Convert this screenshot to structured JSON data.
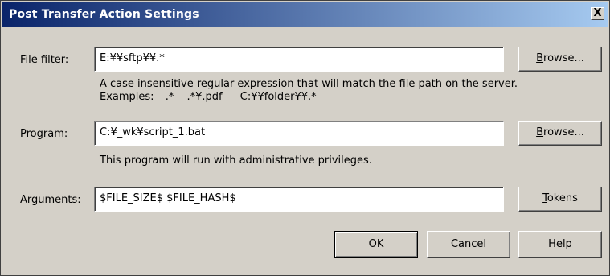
{
  "window": {
    "title": "Post Transfer Action Settings",
    "close_label": "X"
  },
  "file_filter": {
    "label_accel": "F",
    "label_rest": "ile filter:",
    "value": "E:¥¥sftp¥¥.*",
    "browse_accel": "B",
    "browse_rest": "rowse..."
  },
  "description": {
    "line1": "A case insensitive regular expression that will match the file path on the server.",
    "examples_label": "Examples:",
    "examples": [
      ".*",
      ".*¥.pdf",
      "C:¥¥folder¥¥.*"
    ]
  },
  "program": {
    "label_accel": "P",
    "label_rest": "rogram:",
    "value": "C:¥_wk¥script_1.bat",
    "browse_accel": "B",
    "browse_rest": "rowse...",
    "note": "This program will run with administrative privileges."
  },
  "arguments": {
    "label_accel": "A",
    "label_rest": "rguments:",
    "value": "$FILE_SIZE$ $FILE_HASH$",
    "tokens_accel": "T",
    "tokens_rest": "okens"
  },
  "buttons": {
    "ok": "OK",
    "cancel": "Cancel",
    "help": "Help"
  }
}
